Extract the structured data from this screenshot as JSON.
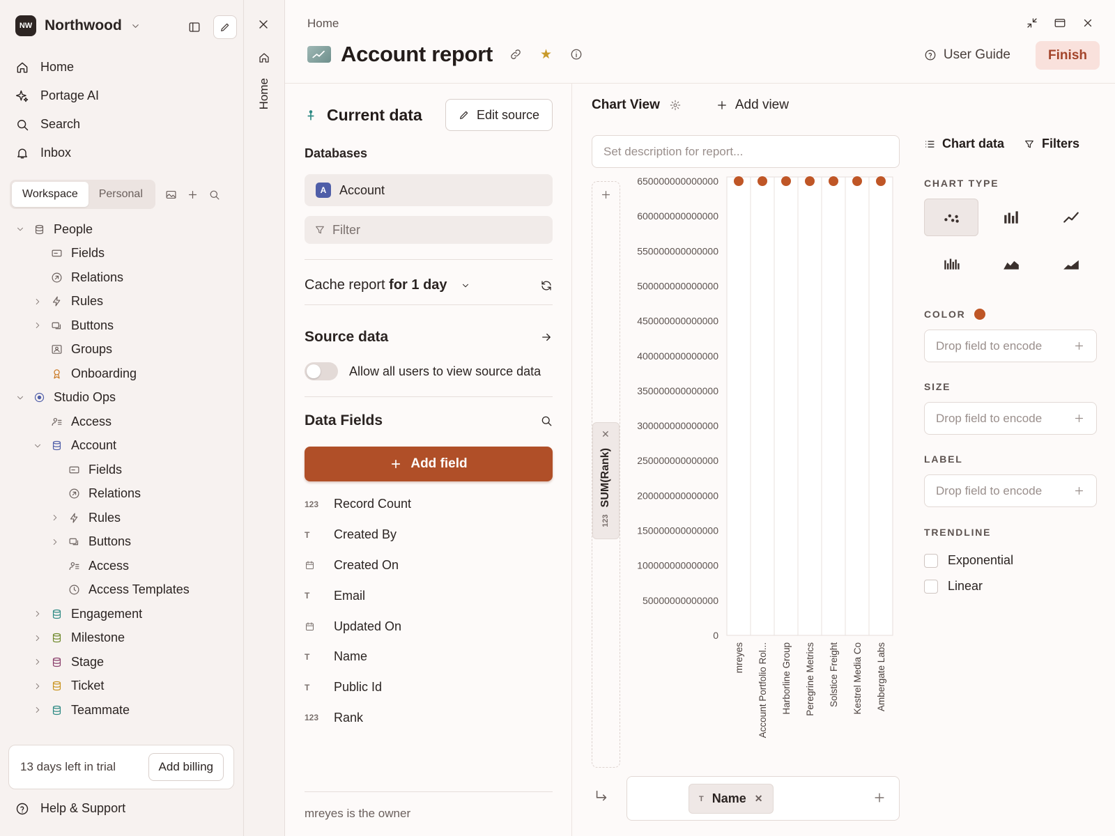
{
  "workspace": {
    "initials": "NW",
    "name": "Northwood"
  },
  "nav": [
    {
      "icon": "home-icon",
      "label": "Home"
    },
    {
      "icon": "sparkle-icon",
      "label": "Portage AI"
    },
    {
      "icon": "search-icon",
      "label": "Search"
    },
    {
      "icon": "bell-icon",
      "label": "Inbox"
    }
  ],
  "tabs": {
    "workspace": "Workspace",
    "personal": "Personal"
  },
  "tree": [
    {
      "label": "People",
      "indent": 0,
      "caret": "down",
      "icon": "db",
      "color": "#6b615e"
    },
    {
      "label": "Fields",
      "indent": 1,
      "caret": "",
      "icon": "fields",
      "color": "#6b615e"
    },
    {
      "label": "Relations",
      "indent": 1,
      "caret": "",
      "icon": "relations",
      "color": "#6b615e"
    },
    {
      "label": "Rules",
      "indent": 1,
      "caret": "right",
      "icon": "bolt",
      "color": "#6b615e"
    },
    {
      "label": "Buttons",
      "indent": 1,
      "caret": "right",
      "icon": "buttons",
      "color": "#6b615e"
    },
    {
      "label": "Groups",
      "indent": 1,
      "caret": "",
      "icon": "groups",
      "color": "#6b615e"
    },
    {
      "label": "Onboarding",
      "indent": 1,
      "caret": "",
      "icon": "award",
      "color": "#c9761f"
    },
    {
      "label": "Studio Ops",
      "indent": 0,
      "caret": "down",
      "icon": "target",
      "color": "#4f5ea8"
    },
    {
      "label": "Access",
      "indent": 1,
      "caret": "",
      "icon": "access",
      "color": "#6b615e"
    },
    {
      "label": "Account",
      "indent": 1,
      "caret": "down",
      "icon": "db",
      "color": "#4f5ea8"
    },
    {
      "label": "Fields",
      "indent": 2,
      "caret": "",
      "icon": "fields",
      "color": "#6b615e"
    },
    {
      "label": "Relations",
      "indent": 2,
      "caret": "",
      "icon": "relations",
      "color": "#6b615e"
    },
    {
      "label": "Rules",
      "indent": 2,
      "caret": "right",
      "icon": "bolt",
      "color": "#6b615e"
    },
    {
      "label": "Buttons",
      "indent": 2,
      "caret": "right",
      "icon": "buttons",
      "color": "#6b615e"
    },
    {
      "label": "Access",
      "indent": 2,
      "caret": "",
      "icon": "access",
      "color": "#6b615e"
    },
    {
      "label": "Access Templates",
      "indent": 2,
      "caret": "",
      "icon": "clock",
      "color": "#6b615e"
    },
    {
      "label": "Engagement",
      "indent": 1,
      "caret": "right",
      "icon": "db",
      "color": "#2e8a84"
    },
    {
      "label": "Milestone",
      "indent": 1,
      "caret": "right",
      "icon": "db",
      "color": "#6f8a2c"
    },
    {
      "label": "Stage",
      "indent": 1,
      "caret": "right",
      "icon": "db",
      "color": "#8a3f6b"
    },
    {
      "label": "Ticket",
      "indent": 1,
      "caret": "right",
      "icon": "db",
      "color": "#c9941f"
    },
    {
      "label": "Teammate",
      "indent": 1,
      "caret": "right",
      "icon": "db",
      "color": "#2e8a84"
    }
  ],
  "trial": {
    "text": "13 days left in trial",
    "button": "Add billing"
  },
  "help": "Help & Support",
  "rail": {
    "label": "Home"
  },
  "header": {
    "breadcrumb": "Home",
    "title": "Account report",
    "guide": "User Guide",
    "finish": "Finish"
  },
  "data_panel": {
    "current_data": "Current data",
    "edit_source": "Edit source",
    "databases_label": "Databases",
    "database": {
      "badge": "A",
      "name": "Account"
    },
    "filter": "Filter",
    "cache_prefix": "Cache report ",
    "cache_bold": "for 1 day",
    "source_data": "Source data",
    "toggle_label": "Allow all users to view source data",
    "data_fields": "Data Fields",
    "add_field": "Add field",
    "fields": [
      {
        "type": "123",
        "name": "Record Count"
      },
      {
        "type": "T",
        "name": "Created By"
      },
      {
        "type": "date",
        "name": "Created On"
      },
      {
        "type": "T",
        "name": "Email"
      },
      {
        "type": "date",
        "name": "Updated On"
      },
      {
        "type": "T",
        "name": "Name"
      },
      {
        "type": "T",
        "name": "Public Id"
      },
      {
        "type": "123",
        "name": "Rank"
      }
    ],
    "owner": "mreyes is the owner"
  },
  "chart_view": {
    "title": "Chart View",
    "add_view": "Add view",
    "description_placeholder": "Set description for report...",
    "y_pill": {
      "type": "123",
      "label": "SUM(Rank)"
    },
    "x_pill": {
      "type": "T",
      "label": "Name"
    }
  },
  "chart_data": {
    "type": "scatter",
    "title": "",
    "xlabel": "Name",
    "ylabel": "SUM(Rank)",
    "categories": [
      "mreyes",
      "Account Portfolio Rol...",
      "Harborline Group",
      "Peregrine Metrics",
      "Solstice Freight",
      "Kestrel Media Co",
      "Ambergate Labs"
    ],
    "values": [
      650000000000000,
      650000000000000,
      650000000000000,
      650000000000000,
      650000000000000,
      650000000000000,
      650000000000000
    ],
    "y_ticks": [
      "650000000000000",
      "600000000000000",
      "550000000000000",
      "500000000000000",
      "450000000000000",
      "400000000000000",
      "350000000000000",
      "300000000000000",
      "250000000000000",
      "200000000000000",
      "150000000000000",
      "100000000000000",
      "50000000000000",
      "0"
    ],
    "ylim": [
      0,
      650000000000000
    ],
    "color": "#bf5626",
    "grid": "vertical"
  },
  "config": {
    "chart_data_tab": "Chart data",
    "filters_tab": "Filters",
    "chart_type_label": "CHART TYPE",
    "color_label": "COLOR",
    "color_value": "#bf5626",
    "size_label": "SIZE",
    "label_label": "LABEL",
    "drop_placeholder": "Drop field to encode",
    "trendline_label": "TRENDLINE",
    "trendlines": [
      "Exponential",
      "Linear"
    ]
  }
}
